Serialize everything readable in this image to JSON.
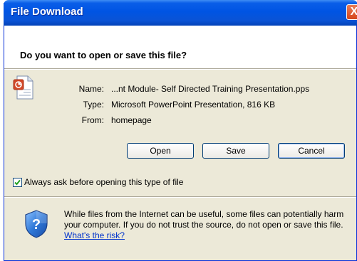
{
  "window": {
    "title": "File Download",
    "close_glyph": "X"
  },
  "dialog": {
    "question": "Do you want to open or save this file?"
  },
  "file": {
    "icon": "powerpoint-file-icon",
    "name_label": "Name:",
    "name_value": "...nt Module- Self Directed Training Presentation.pps",
    "type_label": "Type:",
    "type_value": "Microsoft PowerPoint Presentation, 816 KB",
    "from_label": "From:",
    "from_value": "homepage"
  },
  "buttons": {
    "open": "Open",
    "save": "Save",
    "cancel": "Cancel"
  },
  "checkbox": {
    "label": "Always ask before opening this type of file",
    "checked": true
  },
  "warning": {
    "icon": "security-shield-icon",
    "text": "While files from the Internet can be useful, some files can potentially harm your computer. If you do not trust the source, do not open or save this file. ",
    "link": "What's the risk?"
  },
  "colors": {
    "titlebar": "#0054e3",
    "dialog_bg": "#ece9d8",
    "link": "#0033cc"
  }
}
